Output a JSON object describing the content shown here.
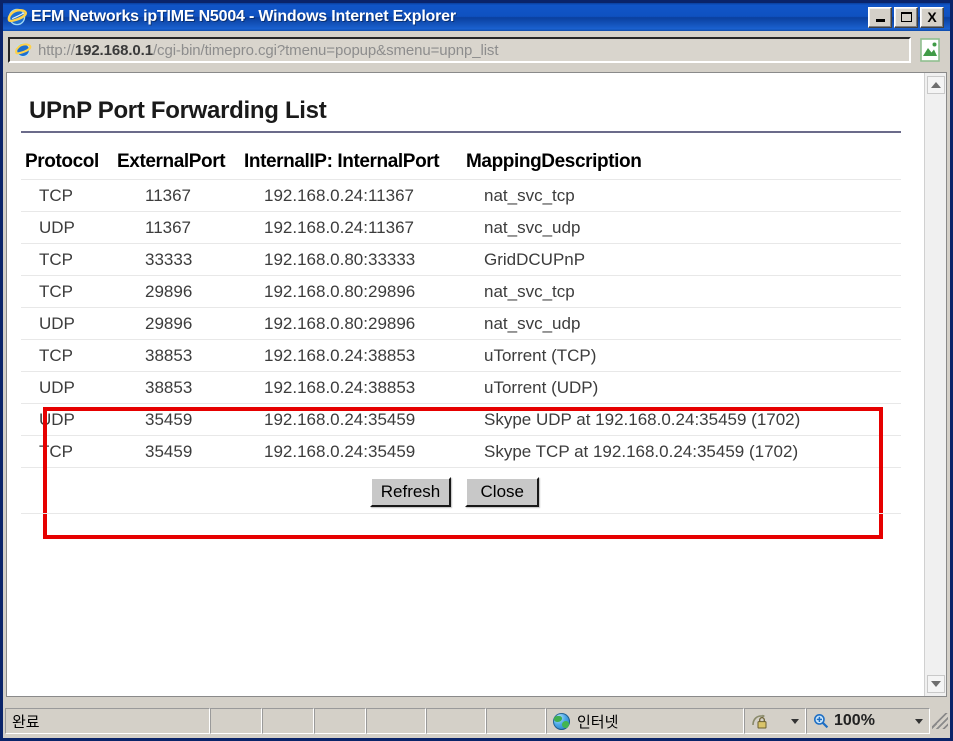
{
  "window": {
    "title": "EFM Networks ipTIME N5004 - Windows Internet Explorer",
    "minimize_label": "Minimize",
    "maximize_label": "Maximize",
    "close_label": "X"
  },
  "address_bar": {
    "url_scheme": "http://",
    "url_host": "192.168.0.1",
    "url_path": "/cgi-bin/timepro.cgi?tmenu=popup&smenu=upnp_list",
    "full_url": "http://192.168.0.1/cgi-bin/timepro.cgi?tmenu=popup&smenu=upnp_list",
    "go_icon": "page-image-icon"
  },
  "page": {
    "title": "UPnP Port Forwarding List",
    "table": {
      "headers": [
        "Protocol",
        "ExternalPort",
        "InternalIP: InternalPort",
        "MappingDescription"
      ],
      "rows": [
        [
          "TCP",
          "11367",
          "192.168.0.24:11367",
          "nat_svc_tcp"
        ],
        [
          "UDP",
          "11367",
          "192.168.0.24:11367",
          "nat_svc_udp"
        ],
        [
          "TCP",
          "33333",
          "192.168.0.80:33333",
          "GridDCUPnP"
        ],
        [
          "TCP",
          "29896",
          "192.168.0.80:29896",
          "nat_svc_tcp"
        ],
        [
          "UDP",
          "29896",
          "192.168.0.80:29896",
          "nat_svc_udp"
        ],
        [
          "TCP",
          "38853",
          "192.168.0.24:38853",
          "uTorrent (TCP)"
        ],
        [
          "UDP",
          "38853",
          "192.168.0.24:38853",
          "uTorrent (UDP)"
        ],
        [
          "UDP",
          "35459",
          "192.168.0.24:35459",
          "Skype UDP at 192.168.0.24:35459 (1702)"
        ],
        [
          "TCP",
          "35459",
          "192.168.0.24:35459",
          "Skype TCP at 192.168.0.24:35459 (1702)"
        ]
      ]
    },
    "highlight": {
      "color": "#e60000",
      "first_row_index": 5,
      "last_row_index": 8
    },
    "buttons": {
      "refresh": "Refresh",
      "close": "Close"
    }
  },
  "scrollbar": {
    "up_icon": "triangle-up-icon",
    "down_icon": "triangle-down-icon"
  },
  "status_bar": {
    "status": "완료",
    "zone_icon": "globe-icon",
    "zone": "인터넷",
    "security_icon": "lock-icon",
    "zoom_icon": "magnifier-icon",
    "zoom_level": "100%"
  }
}
